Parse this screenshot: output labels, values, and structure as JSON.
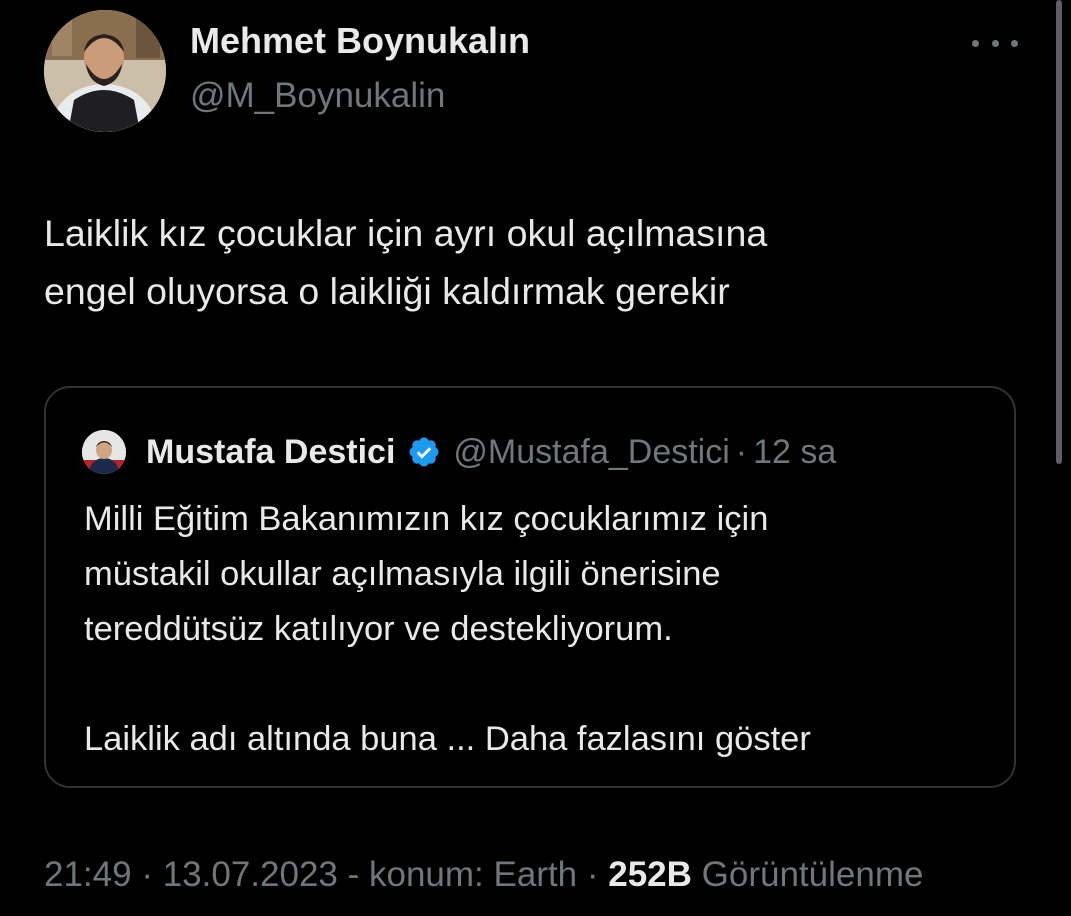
{
  "author": {
    "display_name": "Mehmet Boynukalın",
    "handle": "@M_Boynukalin"
  },
  "tweet": {
    "lines": [
      "Laiklik kız çocuklar için ayrı okul açılmasına",
      "engel oluyorsa o laikliği kaldırmak gerekir"
    ]
  },
  "quoted_tweet": {
    "display_name": "Mustafa Destici",
    "handle": "@Mustafa_Destici",
    "separator": "·",
    "time": "12 sa",
    "lines": [
      "Milli Eğitim Bakanımızın kız çocuklarımız için",
      "müstakil okullar açılmasıyla ilgili önerisine",
      "tereddütsüz katılıyor ve destekliyorum."
    ],
    "truncated_text": "Laiklik adı altında buna ... ",
    "show_more": "Daha fazlasını göster"
  },
  "meta": {
    "time": "21:49",
    "separator": " · ",
    "date": "13.07.2023",
    "location": " - konum: Earth",
    "views_count": "252B",
    "views_label": " Görüntülenme"
  },
  "colors": {
    "background": "#000000",
    "text_primary": "#e7e9ea",
    "text_secondary": "#71767b",
    "border": "#2f3336",
    "verified": "#1d9bf0"
  },
  "icons": {
    "more": "more-dots-icon",
    "verified": "verified-badge-icon"
  }
}
